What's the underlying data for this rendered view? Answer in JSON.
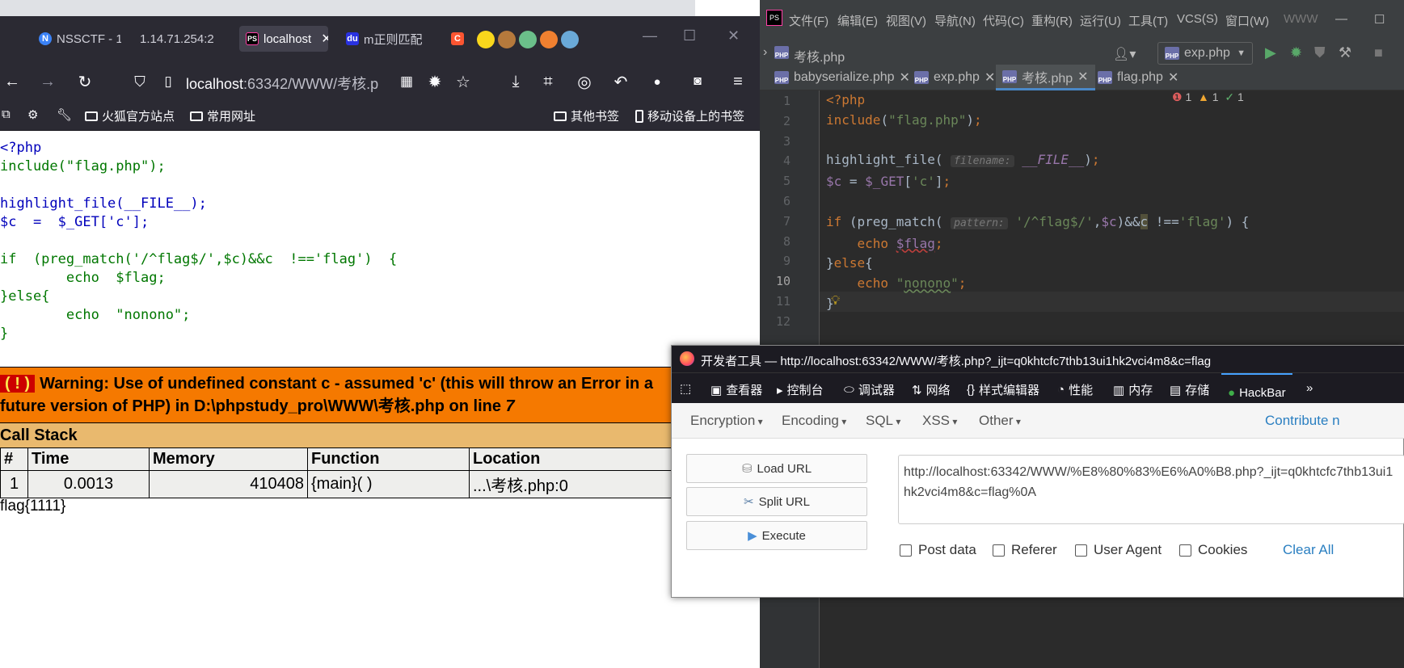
{
  "browser": {
    "tabs": [
      {
        "label": "NSSCTF - 1",
        "icon": "nssctf-icon"
      },
      {
        "label": "1.14.71.254:2",
        "icon": "none"
      },
      {
        "label": "localhost",
        "icon": "phpstorm-icon"
      },
      {
        "label": "m正则匹配",
        "icon": "baidu-icon"
      },
      {
        "label": "C",
        "icon": "csdn-icon"
      }
    ],
    "url_host": "localhost",
    "url_path": ":63342/WWW/考核.p",
    "bookmarks": {
      "left": [
        "火狐官方站点",
        "常用网址"
      ],
      "right": [
        "其他书签",
        "移动设备上的书签"
      ]
    }
  },
  "page": {
    "code_lines": [
      "<?php",
      "include(\"flag.php\");",
      "",
      "highlight_file(__FILE__);",
      "$c  =  $_GET['c'];",
      "",
      "if  (preg_match('/^flag$/',$c)&&c  !=='flag')  {",
      "        echo  $flag;",
      "}else{",
      "        echo  \"nonono\";",
      "}"
    ],
    "warning_icon": "( ! )",
    "warning_text": "Warning: Use of undefined constant c - assumed 'c' (this will throw an Error in a future version of PHP) in D:\\phpstudy_pro\\WWW\\考核.php on line ",
    "warning_line": "7",
    "call_stack_title": "Call Stack",
    "call_stack_headers": [
      "#",
      "Time",
      "Memory",
      "Function",
      "Location"
    ],
    "call_stack_rows": [
      [
        "1",
        "0.0013",
        "410408",
        "{main}( )",
        "...\\考核.php:0"
      ]
    ],
    "flag_output": "flag{1111}"
  },
  "ide": {
    "menu": [
      "文件(F)",
      "编辑(E)",
      "视图(V)",
      "导航(N)",
      "代码(C)",
      "重构(R)",
      "运行(U)",
      "工具(T)",
      "VCS(S)",
      "窗口(W)",
      "WWW"
    ],
    "breadcrumb_file": "考核.php",
    "run_config": "exp.php",
    "tabs": [
      "babyserialize.php",
      "exp.php",
      "考核.php",
      "flag.php"
    ],
    "active_tab": "考核.php",
    "line_numbers": [
      "1",
      "2",
      "3",
      "4",
      "5",
      "6",
      "7",
      "8",
      "9",
      "10",
      "11",
      "12"
    ],
    "inspections": {
      "errors": "1",
      "warnings": "1",
      "ok": "1"
    },
    "hint_filename": "filename:",
    "hint_pattern": "pattern:"
  },
  "devtools": {
    "title": "开发者工具 — http://localhost:63342/WWW/考核.php?_ijt=q0khtcfc7thb13ui1hk2vci4m8&c=flag",
    "tabs": [
      "查看器",
      "控制台",
      "调试器",
      "网络",
      "样式编辑器",
      "性能",
      "内存",
      "存储",
      "HackBar"
    ],
    "active_tab": "HackBar",
    "hackbar": {
      "menus": [
        "Encryption",
        "Encoding",
        "SQL",
        "XSS",
        "Other"
      ],
      "contribute": "Contribute n",
      "buttons": [
        "Load URL",
        "Split URL",
        "Execute"
      ],
      "url_value": "http://localhost:63342/WWW/%E8%80%83%E6%A0%B8.php?_ijt=q0khtcfc7thb13ui1hk2vci4m8&c=flag%0A",
      "checkboxes": [
        "Post data",
        "Referer",
        "User Agent",
        "Cookies"
      ],
      "clear_all": "Clear All"
    }
  }
}
